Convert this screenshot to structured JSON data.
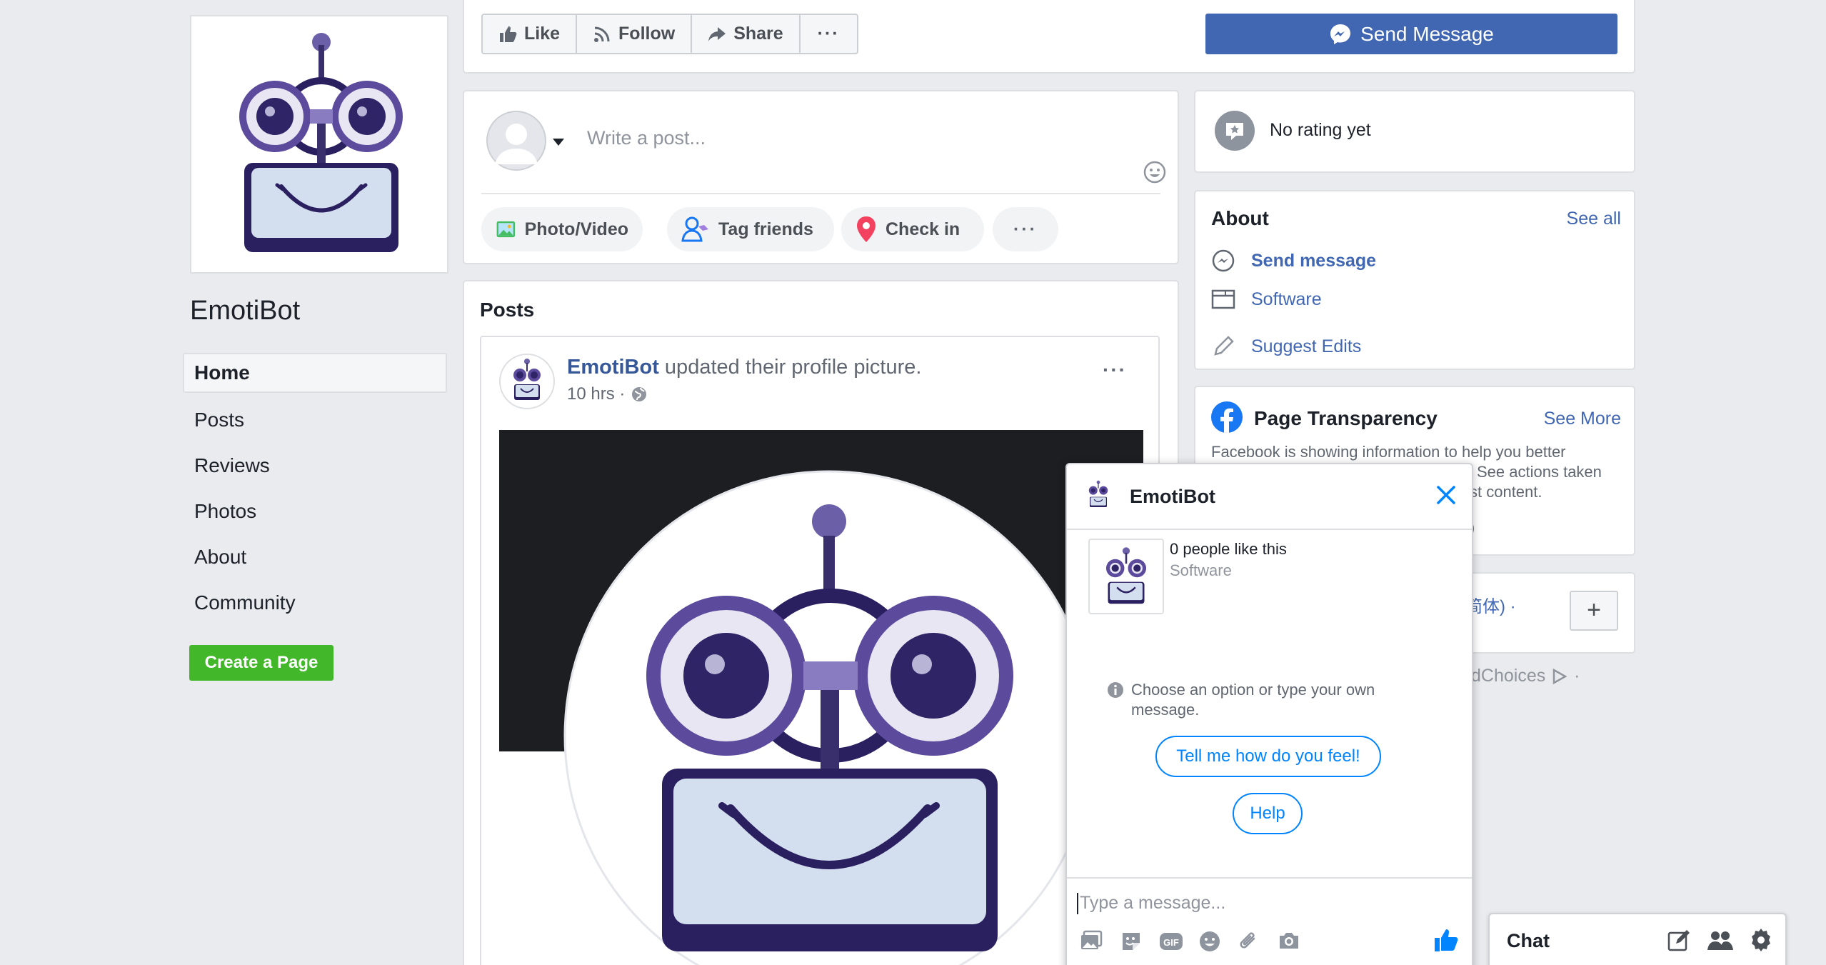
{
  "page": {
    "name": "EmotiBot"
  },
  "left_nav": {
    "items": [
      {
        "label": "Home",
        "active": true
      },
      {
        "label": "Posts",
        "active": false
      },
      {
        "label": "Reviews",
        "active": false
      },
      {
        "label": "Photos",
        "active": false
      },
      {
        "label": "About",
        "active": false
      },
      {
        "label": "Community",
        "active": false
      }
    ],
    "create_page": "Create a Page"
  },
  "action_bar": {
    "like": "Like",
    "follow": "Follow",
    "share": "Share",
    "more": "···",
    "send_message": "Send Message"
  },
  "composer": {
    "placeholder": "Write a post...",
    "actions": [
      "Photo/Video",
      "Tag friends",
      "Check in",
      "···"
    ]
  },
  "posts": {
    "title": "Posts",
    "post": {
      "author": "EmotiBot",
      "action_text": " updated their profile picture.",
      "time": "10 hrs ·"
    }
  },
  "rating": {
    "text": "No rating yet"
  },
  "about": {
    "title": "About",
    "see_all": "See all",
    "rows": [
      "Send message",
      "Software",
      "Suggest Edits"
    ]
  },
  "transparency": {
    "title": "Page Transparency",
    "see_more": "See More",
    "line1": "Facebook is showing information to help you better",
    "line2_visible": "See actions taken",
    "line3_visible": "st content.",
    "line4_visible": ")"
  },
  "language": {
    "visible_text": "(简体) ·",
    "add": "+",
    "adchoices_visible": "dChoices"
  },
  "chat_window": {
    "title": "EmotiBot",
    "likes": "0 people like this",
    "category": "Software",
    "hint": "Choose an option or type your own message.",
    "quick_replies": [
      "Tell me how do you feel!",
      "Help"
    ],
    "input_placeholder": "Type a message..."
  },
  "chat_bar": {
    "label": "Chat"
  },
  "colors": {
    "brand_blue": "#4267b2",
    "messenger_blue": "#0084ff",
    "create_green": "#42b72a",
    "robot_purple": "#5c4a9c"
  }
}
